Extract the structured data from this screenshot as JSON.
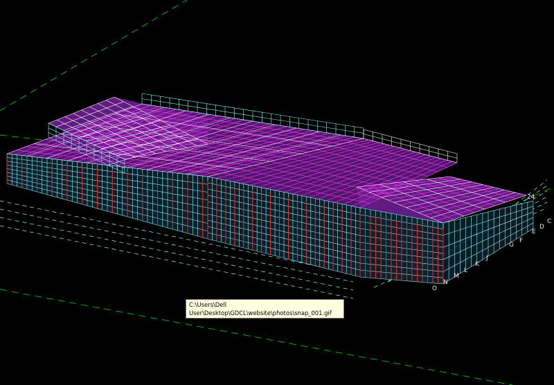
{
  "viewport": {
    "background": "#000000",
    "gridline_color": "#00b400",
    "frame_color_primary": "#7fffff",
    "frame_color_white": "#ffffff",
    "member_color_magenta": "#ff33ff",
    "member_color_purple": "#7a1fa8",
    "member_color_red": "#ff2020"
  },
  "axis_labels": {
    "top_row": [
      "24"
    ],
    "right_column": [
      "E",
      "D",
      "C"
    ],
    "bottom_row": [
      "G",
      "F",
      "J",
      "K",
      "L",
      "M",
      "N",
      "O"
    ]
  },
  "tooltip": {
    "line1": "C:\\Users\\Dell",
    "line2": "User\\Desktop\\GDCL\\website\\photos\\snap_001.gif"
  }
}
